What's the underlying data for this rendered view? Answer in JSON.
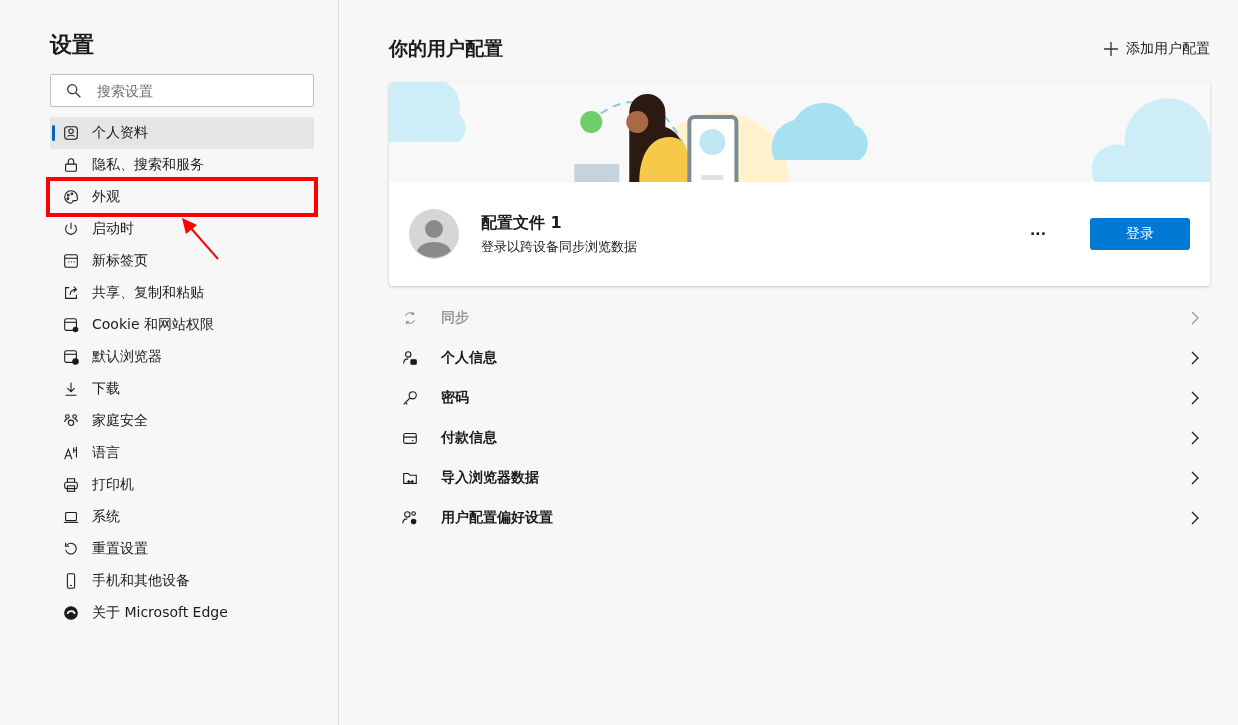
{
  "sidebar": {
    "title": "设置",
    "search": {
      "placeholder": "搜索设置"
    },
    "items": [
      {
        "label": "个人资料",
        "selected": true
      },
      {
        "label": "隐私、搜索和服务",
        "selected": false
      },
      {
        "label": "外观",
        "selected": false
      },
      {
        "label": "启动时",
        "selected": false
      },
      {
        "label": "新标签页",
        "selected": false
      },
      {
        "label": "共享、复制和粘贴",
        "selected": false
      },
      {
        "label": "Cookie 和网站权限",
        "selected": false
      },
      {
        "label": "默认浏览器",
        "selected": false
      },
      {
        "label": "下载",
        "selected": false
      },
      {
        "label": "家庭安全",
        "selected": false
      },
      {
        "label": "语言",
        "selected": false
      },
      {
        "label": "打印机",
        "selected": false
      },
      {
        "label": "系统",
        "selected": false
      },
      {
        "label": "重置设置",
        "selected": false
      },
      {
        "label": "手机和其他设备",
        "selected": false
      },
      {
        "label": "关于 Microsoft Edge",
        "selected": false
      }
    ]
  },
  "main": {
    "title": "你的用户配置",
    "add_profile": "添加用户配置",
    "profile": {
      "name": "配置文件 1",
      "subtitle": "登录以跨设备同步浏览数据",
      "more": "···",
      "sign_in": "登录"
    },
    "rows": [
      {
        "label": "同步",
        "disabled": true
      },
      {
        "label": "个人信息",
        "disabled": false
      },
      {
        "label": "密码",
        "disabled": false
      },
      {
        "label": "付款信息",
        "disabled": false
      },
      {
        "label": "导入浏览器数据",
        "disabled": false
      },
      {
        "label": "用户配置偏好设置",
        "disabled": false
      }
    ]
  }
}
